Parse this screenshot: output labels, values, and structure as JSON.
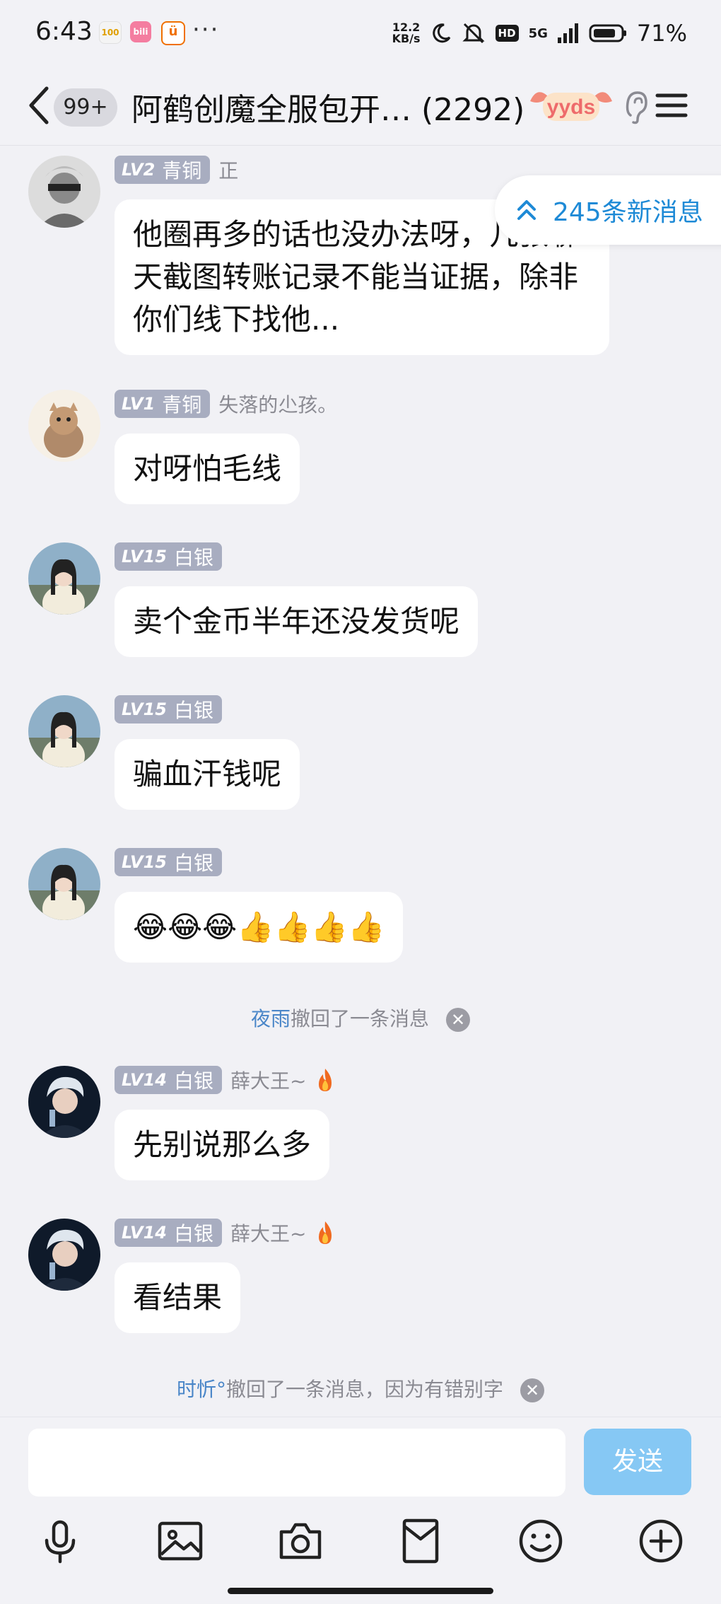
{
  "status_bar": {
    "time": "6:43",
    "net_speed_value": "12.2",
    "net_speed_unit": "KB/s",
    "hd_label": "HD",
    "network": "5G",
    "battery": "71%",
    "more_icon": "more-dots-icon",
    "app_icons": [
      "100-app-icon",
      "bilibili-app-icon",
      "taobao-app-icon"
    ]
  },
  "header": {
    "unread_count": "99+",
    "title": "阿鹤创魔全服包开…",
    "member_count": "(2292)",
    "badge_text": "yyds"
  },
  "new_messages_tip": {
    "label": "245条新消息"
  },
  "messages": [
    {
      "level": "LV2",
      "rank": "青铜",
      "nickname": "正",
      "lines": [
        "他圈再多的话也没办法呀，几张聊",
        "天截图转账记录不能当证据，除非",
        "你们线下找他..."
      ]
    },
    {
      "level": "LV1",
      "rank": "青铜",
      "nickname": "失落的尐孩。",
      "lines": [
        "对呀怕毛线"
      ]
    },
    {
      "level": "LV15",
      "rank": "白银",
      "nickname": "",
      "lines": [
        "卖个金币半年还没发货呢"
      ]
    },
    {
      "level": "LV15",
      "rank": "白银",
      "nickname": "",
      "lines": [
        "骗血汗钱呢"
      ]
    },
    {
      "level": "LV15",
      "rank": "白银",
      "nickname": "",
      "lines": [
        "😂😂😂👍👍👍👍"
      ]
    },
    {
      "level": "LV14",
      "rank": "白银",
      "nickname": "薛大王~",
      "lines": [
        "先别说那么多"
      ]
    },
    {
      "level": "LV14",
      "rank": "白银",
      "nickname": "薛大王~",
      "lines": [
        "看结果"
      ]
    }
  ],
  "recalls": [
    {
      "who": "夜雨",
      "text": "撤回了一条消息"
    },
    {
      "who": "时忻°",
      "text": "撤回了一条消息，因为有错别字"
    }
  ],
  "input": {
    "placeholder": "",
    "send_label": "发送"
  },
  "toolbar": [
    "microphone-icon",
    "image-icon",
    "camera-icon",
    "red-packet-icon",
    "emoji-icon",
    "plus-icon"
  ],
  "colors": {
    "accent": "#1e8ad6",
    "send_disabled": "#86c8f4",
    "badge": "#a8adc0",
    "background": "#f1f1f5"
  }
}
